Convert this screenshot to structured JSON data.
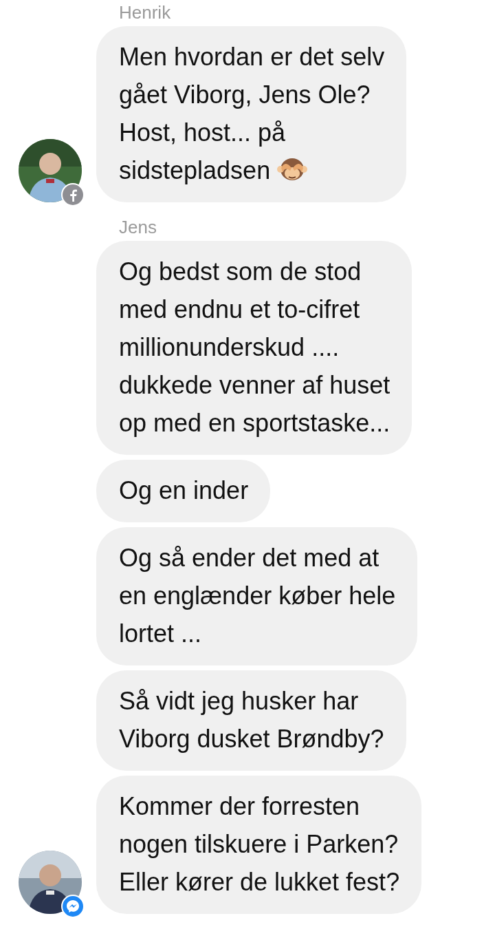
{
  "groups": [
    {
      "sender": "Henrik",
      "avatar_badge": {
        "kind": "facebook"
      },
      "messages": [
        {
          "lines": [
            "Men hvordan er det selv",
            "gået Viborg, Jens Ole?",
            "Host, host... på",
            "sidstepladsen"
          ],
          "trailing_emoji": {
            "kind": "see-no-evil"
          }
        }
      ]
    },
    {
      "sender": "Jens",
      "avatar_badge": {
        "kind": "messenger"
      },
      "messages": [
        {
          "lines": [
            "Og bedst som de stod",
            "med endnu et to-cifret",
            "millionunderskud ....",
            "dukkede venner af huset",
            "op med en sportstaske..."
          ]
        },
        {
          "lines": [
            "Og en inder"
          ]
        },
        {
          "lines": [
            "Og så ender det med at",
            "en englænder køber hele",
            "lortet ..."
          ]
        },
        {
          "lines": [
            "Så vidt jeg husker har",
            "Viborg dusket Brøndby?"
          ]
        },
        {
          "lines": [
            "Kommer der forresten",
            "nogen tilskuere i Parken?",
            "Eller kører de lukket fest?"
          ]
        }
      ]
    }
  ]
}
